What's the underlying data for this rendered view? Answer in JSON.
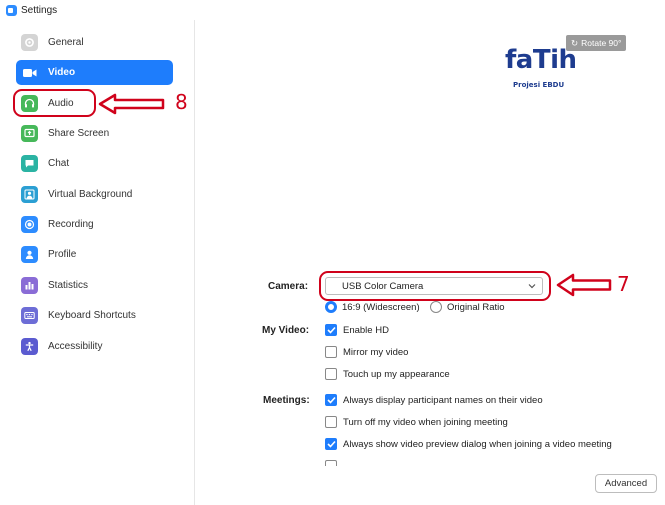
{
  "window": {
    "title": "Settings"
  },
  "sidebar": {
    "items": [
      {
        "label": "General",
        "icon": "gear-icon",
        "color": "#c8c8c8"
      },
      {
        "label": "Video",
        "icon": "video-camera-icon",
        "color": "#1e7dfc",
        "active": true
      },
      {
        "label": "Audio",
        "icon": "headphones-icon",
        "color": "#46b85a"
      },
      {
        "label": "Share Screen",
        "icon": "share-screen-icon",
        "color": "#46b85a"
      },
      {
        "label": "Chat",
        "icon": "chat-bubble-icon",
        "color": "#2bb3a3"
      },
      {
        "label": "Virtual Background",
        "icon": "person-background-icon",
        "color": "#2b9fd3"
      },
      {
        "label": "Recording",
        "icon": "record-icon",
        "color": "#2d8cff"
      },
      {
        "label": "Profile",
        "icon": "person-icon",
        "color": "#2d8cff"
      },
      {
        "label": "Statistics",
        "icon": "bar-chart-icon",
        "color": "#8a6cd6"
      },
      {
        "label": "Keyboard Shortcuts",
        "icon": "keyboard-icon",
        "color": "#6d6dd6"
      },
      {
        "label": "Accessibility",
        "icon": "accessibility-icon",
        "color": "#5b5bd0"
      }
    ]
  },
  "annotations": {
    "audio_number": "8",
    "camera_number": "7",
    "color": "#d0021b"
  },
  "logo": {
    "word": "faTih",
    "subtitle": "Projesi EBDU"
  },
  "preview": {
    "rotate_label": "Rotate 90°"
  },
  "camera": {
    "label": "Camera:",
    "selected": "USB Color Camera",
    "ratio_options": [
      {
        "label": "16:9 (Widescreen)",
        "selected": true
      },
      {
        "label": "Original Ratio",
        "selected": false
      }
    ]
  },
  "my_video": {
    "label": "My Video:",
    "options": [
      {
        "label": "Enable HD",
        "checked": true
      },
      {
        "label": "Mirror my video",
        "checked": false
      },
      {
        "label": "Touch up my appearance",
        "checked": false
      }
    ]
  },
  "meetings": {
    "label": "Meetings:",
    "options": [
      {
        "label": "Always display participant names on their video",
        "checked": true
      },
      {
        "label": "Turn off my video when joining meeting",
        "checked": false
      },
      {
        "label": "Always show video preview dialog when joining a video meeting",
        "checked": true
      }
    ]
  },
  "advanced_label": "Advanced"
}
